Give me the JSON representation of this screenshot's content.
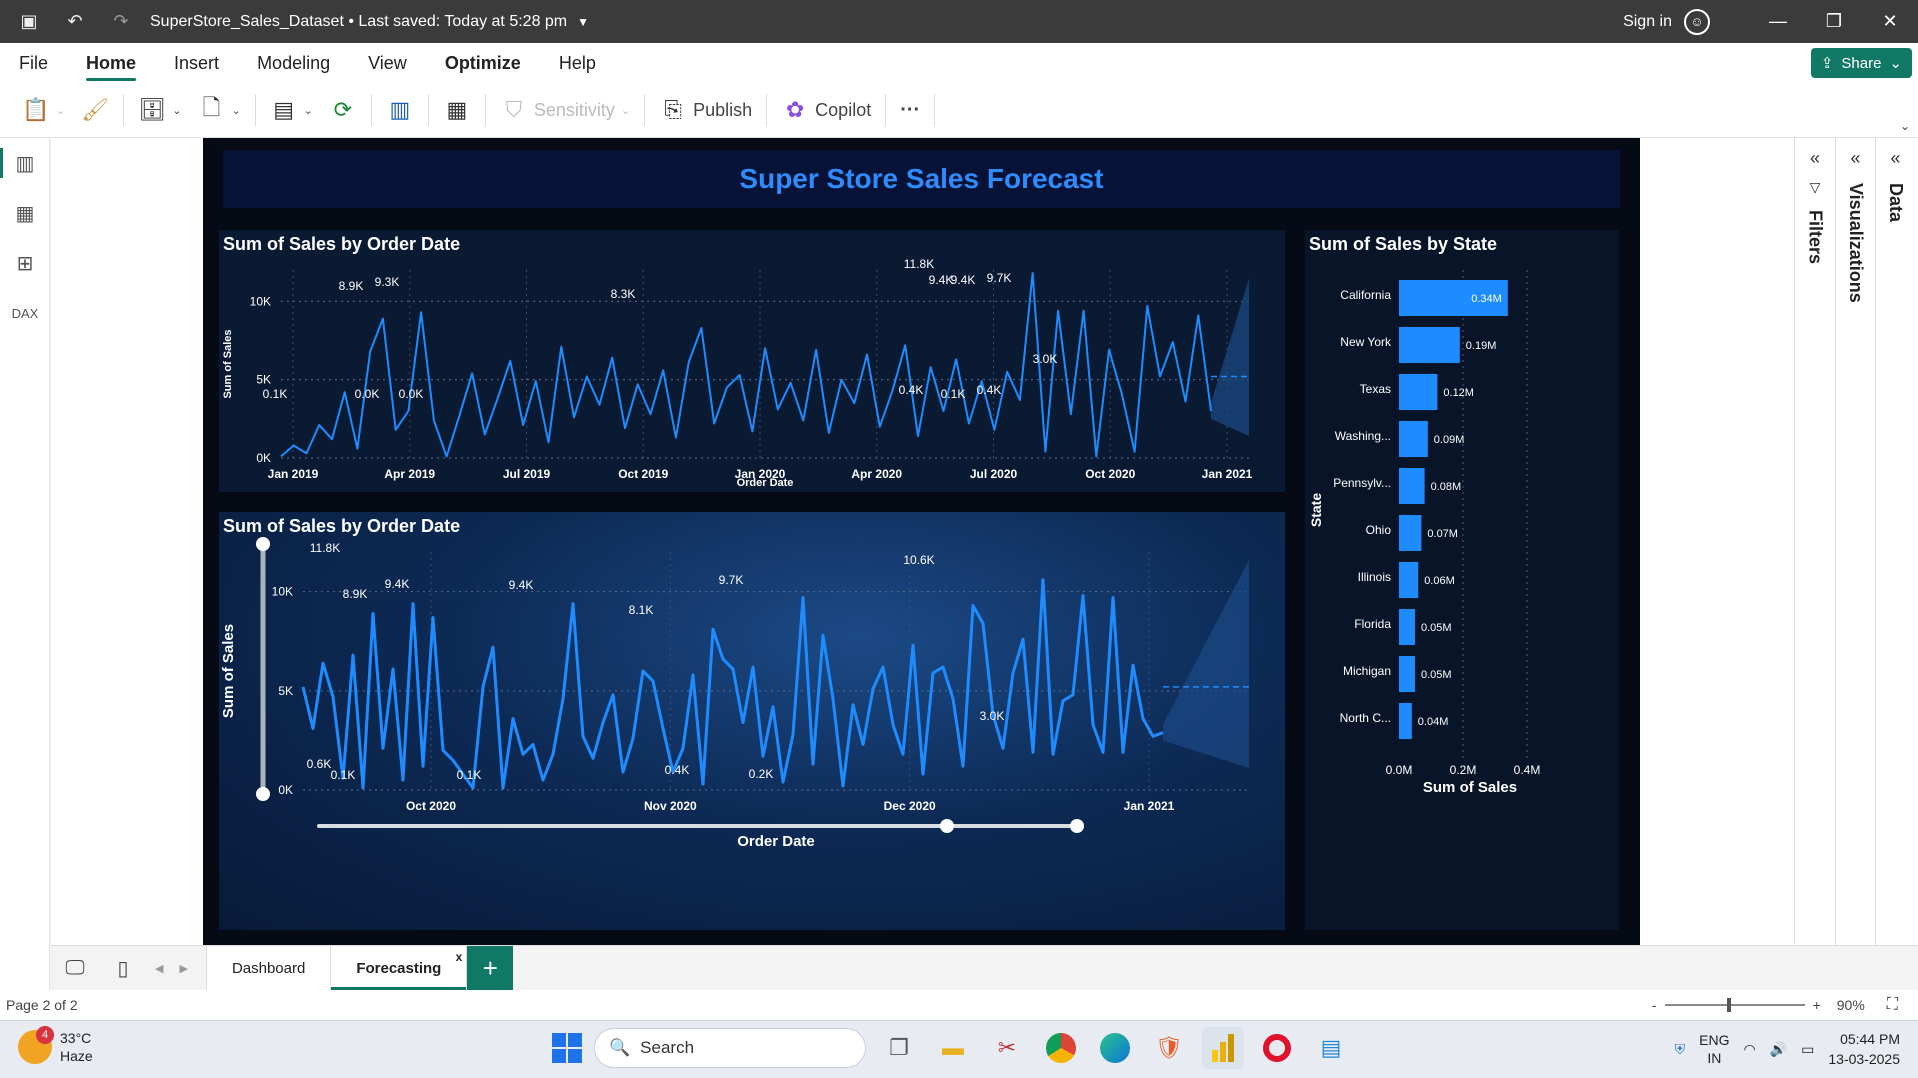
{
  "titlebar": {
    "title": "SuperStore_Sales_Dataset",
    "saved": "Last saved: Today at 5:28 pm",
    "sign_in": "Sign in"
  },
  "menu": [
    "File",
    "Home",
    "Insert",
    "Modeling",
    "View",
    "Optimize",
    "Help"
  ],
  "share_label": "Share",
  "ribbon": {
    "sensitivity": "Sensitivity",
    "publish": "Publish",
    "copilot": "Copilot",
    "more": "···"
  },
  "report": {
    "title": "Super Store Sales Forecast"
  },
  "chart_data": [
    {
      "type": "line",
      "title": "Sum of Sales by Order Date",
      "xlabel": "Order Date",
      "ylabel": "Sum of Sales",
      "ylim": [
        0,
        12000
      ],
      "y_ticks": [
        "0K",
        "5K",
        "10K"
      ],
      "x_ticks": [
        "Jan 2019",
        "Apr 2019",
        "Jul 2019",
        "Oct 2019",
        "Jan 2020",
        "Apr 2020",
        "Jul 2020",
        "Oct 2020",
        "Jan 2021"
      ],
      "series": [
        {
          "values": [
            100,
            800,
            300,
            2100,
            1200,
            4200,
            600,
            6800,
            8900,
            1800,
            3000,
            9300,
            2400,
            100,
            2700,
            5400,
            1500,
            3800,
            6200,
            2100,
            4900,
            1000,
            7100,
            2600,
            5200,
            3400,
            6400,
            1900,
            4700,
            2800,
            5600,
            1300,
            6100,
            8300,
            2200,
            4500,
            5300,
            1700,
            7000,
            3100,
            4800,
            2400,
            6900,
            1600,
            5000,
            3500,
            6600,
            2000,
            4300,
            7200,
            1400,
            5800,
            3000,
            6300,
            2200,
            4900,
            1800,
            5500,
            3700,
            11800,
            400,
            9400,
            2800,
            9400,
            100,
            6900,
            4100,
            400,
            9700,
            5200,
            7400,
            3600,
            9100,
            3000
          ]
        }
      ],
      "data_labels": [
        "8.9K",
        "9.3K",
        "8.3K",
        "11.8K",
        "9.4K",
        "9.4K",
        "9.7K",
        "3.0K",
        "0.1K",
        "0.0K",
        "0.0K",
        "0.4K",
        "0.1K",
        "0.4K"
      ],
      "forecast": true,
      "grid": true
    },
    {
      "type": "line",
      "title": "Sum of Sales by Order Date",
      "xlabel": "Order Date",
      "ylabel": "Sum of Sales",
      "ylim": [
        0,
        12000
      ],
      "y_ticks": [
        "0K",
        "5K",
        "10K"
      ],
      "x_ticks": [
        "Oct 2020",
        "Nov 2020",
        "Dec 2020",
        "Jan 2021"
      ],
      "series": [
        {
          "values": [
            5200,
            3100,
            6400,
            4700,
            600,
            6800,
            100,
            8900,
            2100,
            6100,
            500,
            9400,
            1200,
            8700,
            2000,
            1500,
            800,
            100,
            5200,
            7200,
            100,
            3600,
            1800,
            2300,
            500,
            1800,
            4600,
            9400,
            2700,
            1600,
            3400,
            4800,
            900,
            2600,
            6000,
            5500,
            3100,
            900,
            2100,
            5800,
            300,
            8100,
            6600,
            6100,
            3400,
            6200,
            1700,
            4200,
            400,
            2800,
            9700,
            1300,
            7800,
            4600,
            200,
            4300,
            2300,
            5100,
            6200,
            3300,
            1800,
            7300,
            800,
            5900,
            6200,
            4600,
            1200,
            9300,
            8400,
            3800,
            2100,
            5900,
            7600,
            1900,
            10600,
            1800,
            4500,
            4800,
            9800,
            3300,
            1900,
            9700,
            1900,
            6300,
            3600,
            2700,
            2900
          ]
        }
      ],
      "data_labels": [
        "11.8K",
        "8.9K",
        "9.4K",
        "9.4K",
        "8.1K",
        "9.7K",
        "10.6K",
        "3.0K",
        "0.6K",
        "0.1K",
        "0.1K",
        "0.4K",
        "0.2K"
      ],
      "forecast": true,
      "grid": true
    },
    {
      "type": "bar",
      "orientation": "horizontal",
      "title": "Sum of Sales by State",
      "xlabel": "Sum of Sales",
      "ylabel": "State",
      "xlim": [
        0,
        0.4
      ],
      "x_ticks": [
        "0.0M",
        "0.2M",
        "0.4M"
      ],
      "categories": [
        "California",
        "New York",
        "Texas",
        "Washing...",
        "Pennsylv...",
        "Ohio",
        "Illinois",
        "Florida",
        "Michigan",
        "North C..."
      ],
      "values": [
        0.34,
        0.19,
        0.12,
        0.09,
        0.08,
        0.07,
        0.06,
        0.05,
        0.05,
        0.04
      ],
      "labels": [
        "0.34M",
        "0.19M",
        "0.12M",
        "0.09M",
        "0.08M",
        "0.07M",
        "0.06M",
        "0.05M",
        "0.05M",
        "0.04M"
      ]
    }
  ],
  "panes": {
    "filters": "Filters",
    "visualizations": "Visualizations",
    "data": "Data"
  },
  "tabs": [
    "Dashboard",
    "Forecasting"
  ],
  "status": {
    "page": "Page 2 of 2",
    "zoom": "90%"
  },
  "taskbar": {
    "temp": "33°C",
    "weather": "Haze",
    "badge": "4",
    "search": "Search",
    "lang1": "ENG",
    "lang2": "IN",
    "time": "05:44 PM",
    "date": "13-03-2025"
  },
  "colors": {
    "accent": "#117865",
    "series": "#1e8cff",
    "report_bg": "#050a14"
  }
}
